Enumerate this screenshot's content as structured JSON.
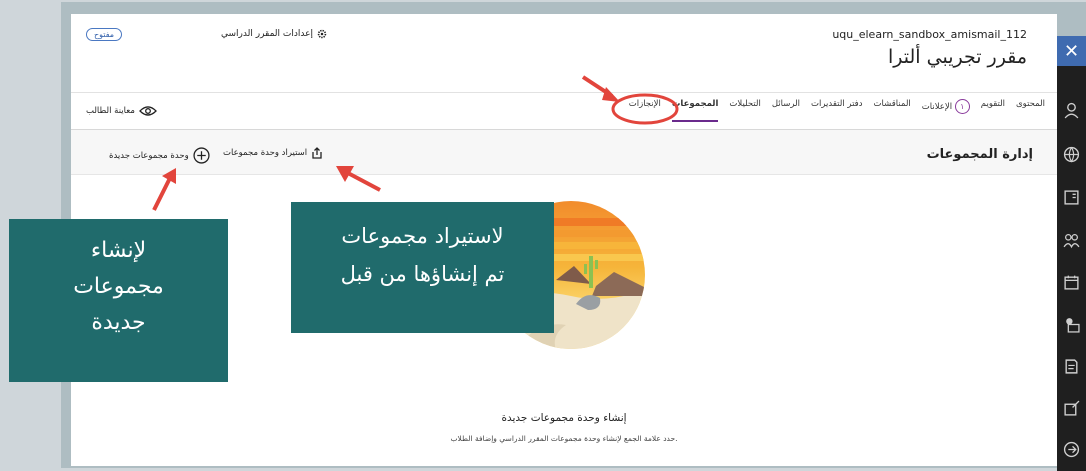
{
  "course": {
    "id": "uqu_elearn_sandbox_amismail_112",
    "title": "مقرر تجريبي ألترا",
    "settings_label": "إعدادات المقرر الدراسي",
    "status_badge": "مفتوح"
  },
  "tabs": [
    {
      "label": "المحتوى",
      "active": false
    },
    {
      "label": "التقويم",
      "active": false
    },
    {
      "label": "الإعلانات",
      "active": false,
      "badge": "١"
    },
    {
      "label": "المناقشات",
      "active": false
    },
    {
      "label": "دفتر التقديرات",
      "active": false
    },
    {
      "label": "الرسائل",
      "active": false
    },
    {
      "label": "التحليلات",
      "active": false
    },
    {
      "label": "المجموعات",
      "active": true
    },
    {
      "label": "الإنجازات",
      "active": false
    }
  ],
  "student_preview": "معاينة الطالب",
  "page": {
    "title": "إدارة المجموعات",
    "new_group_set": "وحدة مجموعات جديدة",
    "import_group_set": "استيراد وحدة مجموعات",
    "empty_title": "إنشاء وحدة مجموعات جديدة",
    "empty_desc": "حدد علامة الجمع لإنشاء وحدة مجموعات المقرر الدراسي وإضافة الطلاب."
  },
  "callouts": {
    "create_lines": [
      "لإنشاء",
      "مجموعات",
      "جديدة"
    ],
    "import_lines": [
      "لاستيراد مجموعات",
      "تم إنشاؤها من قبل"
    ]
  },
  "colors": {
    "accent": "#6a2a8c",
    "callout_bg": "#206b6c",
    "arrow": "#e2453c",
    "close_button": "#3f6bb0"
  },
  "icons": {
    "close": "close-icon",
    "settings": "gear-icon",
    "preview": "eye-icon",
    "add": "plus-circle-icon",
    "import": "import-icon"
  }
}
